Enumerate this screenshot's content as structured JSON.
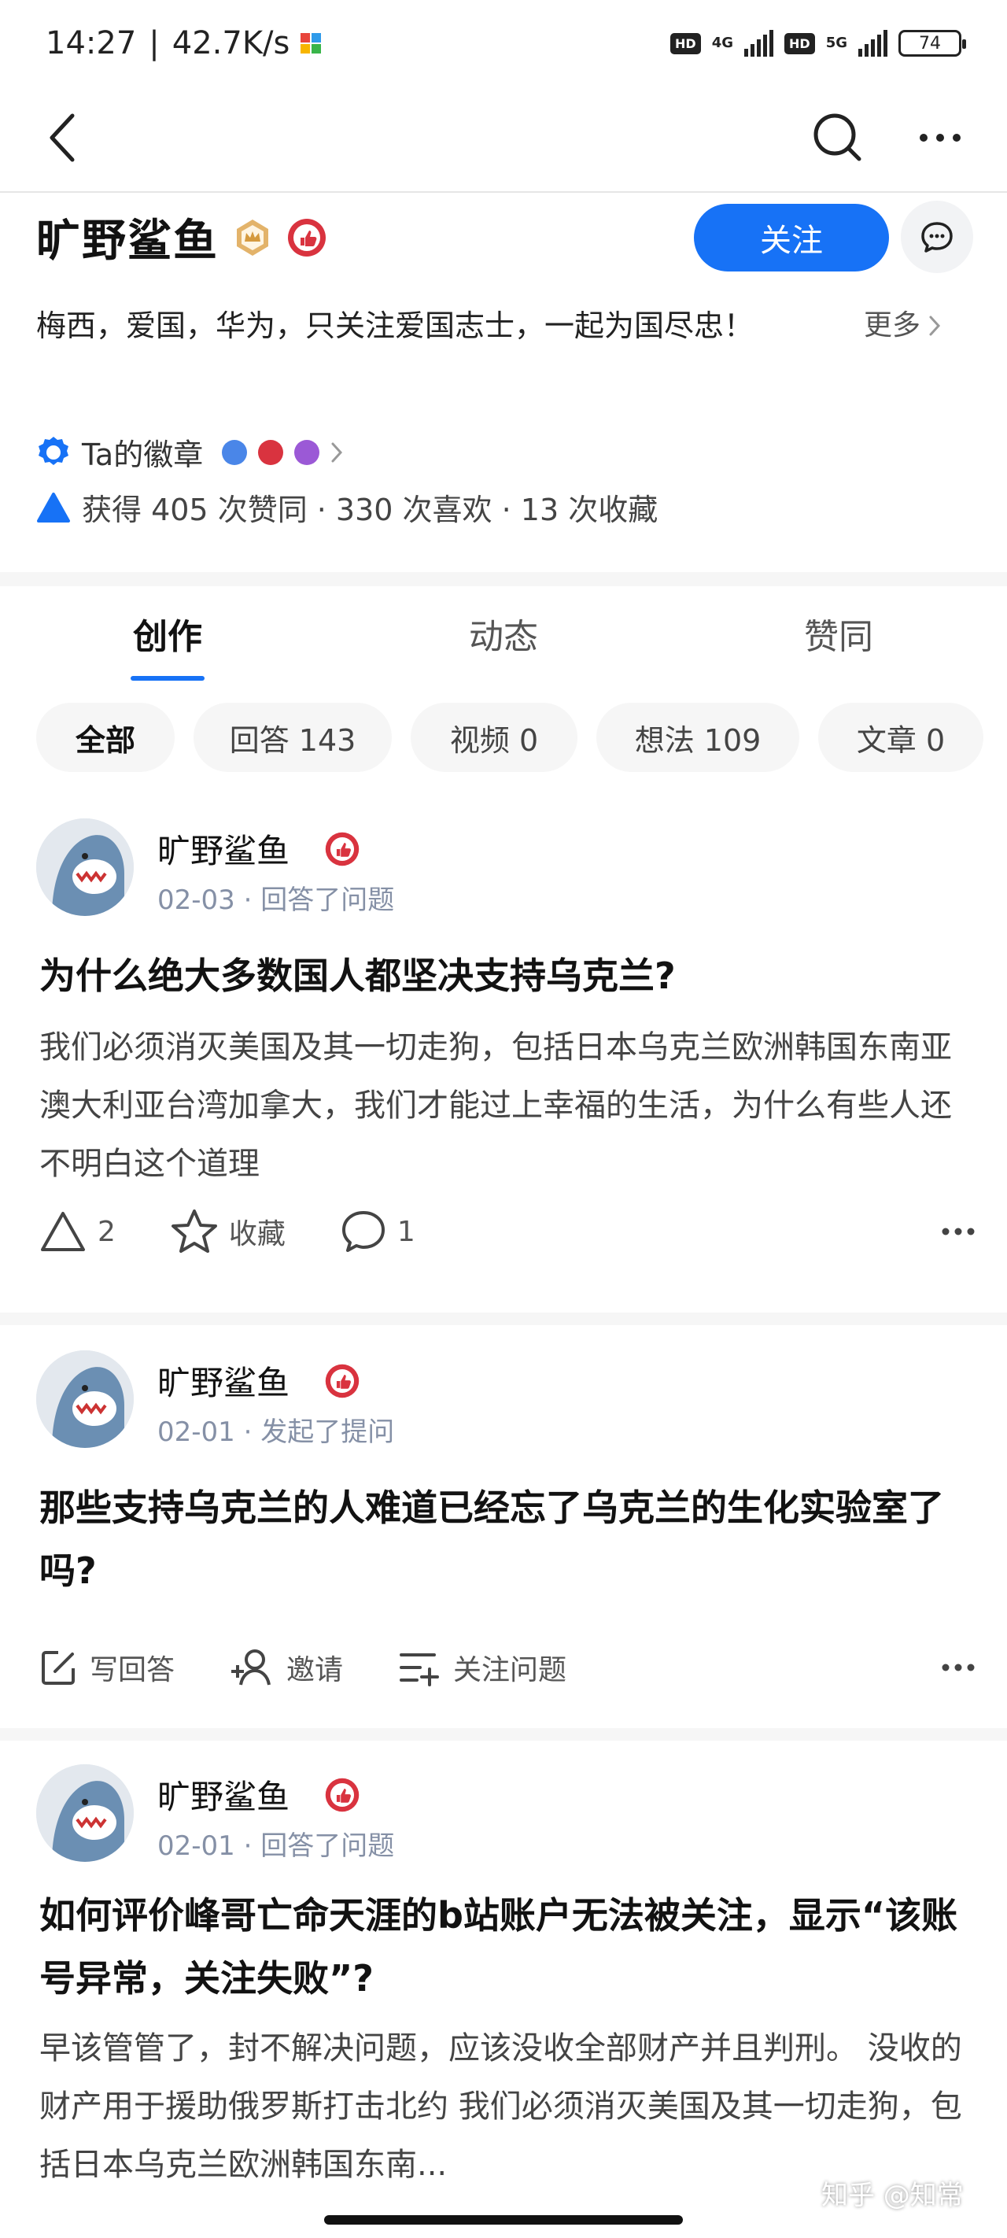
{
  "status_bar": {
    "time": "14:27",
    "speed": "42.7K/s",
    "net1": "4G",
    "net2": "5G",
    "hd": "HD",
    "battery": "74"
  },
  "profile": {
    "name": "旷野鲨鱼",
    "follow_label": "关注",
    "bio": "梅西，爱国，华为，只关注爱国志士，一起为国尽忠！",
    "more_label": "更多",
    "medal_label": "Ta的徽章",
    "stats_label": "获得 405 次赞同 · 330 次喜欢 · 13 次收藏"
  },
  "tabs": [
    {
      "label": "创作",
      "active": true
    },
    {
      "label": "动态",
      "active": false
    },
    {
      "label": "赞同",
      "active": false
    }
  ],
  "chips": [
    {
      "label": "全部",
      "active": true
    },
    {
      "label": "回答 143",
      "active": false
    },
    {
      "label": "视频 0",
      "active": false
    },
    {
      "label": "想法 109",
      "active": false
    },
    {
      "label": "文章 0",
      "active": false
    }
  ],
  "feed": [
    {
      "author": "旷野鲨鱼",
      "meta": "02-03 · 回答了问题",
      "title": "为什么绝大多数国人都坚决支持乌克兰?",
      "excerpt": "我们必须消灭美国及其一切走狗，包括日本乌克兰欧洲韩国东南亚澳大利亚台湾加拿大，我们才能过上幸福的生活，为什么有些人还不明白这个道理",
      "actions": {
        "vote": "2",
        "collect": "收藏",
        "comment": "1"
      }
    },
    {
      "author": "旷野鲨鱼",
      "meta": "02-01 · 发起了提问",
      "title": "那些支持乌克兰的人难道已经忘了乌克兰的生化实验室了吗?",
      "actions": {
        "answer": "写回答",
        "invite": "邀请",
        "follow_q": "关注问题"
      }
    },
    {
      "author": "旷野鲨鱼",
      "meta": "02-01 · 回答了问题",
      "title": "如何评价峰哥亡命天涯的b站账户无法被关注，显示“该账号异常，关注失败”?",
      "excerpt": "早该管管了，封不解决问题，应该没收全部财产并且判刑。 没收的财产用于援助俄罗斯打击北约 我们必须消灭美国及其一切走狗，包括日本乌克兰欧洲韩国东南..."
    }
  ],
  "watermark": "知乎 @知常",
  "colors": {
    "accent": "#1772f6",
    "badge_red": "#d9333f",
    "meta_gray": "#8590a6"
  }
}
